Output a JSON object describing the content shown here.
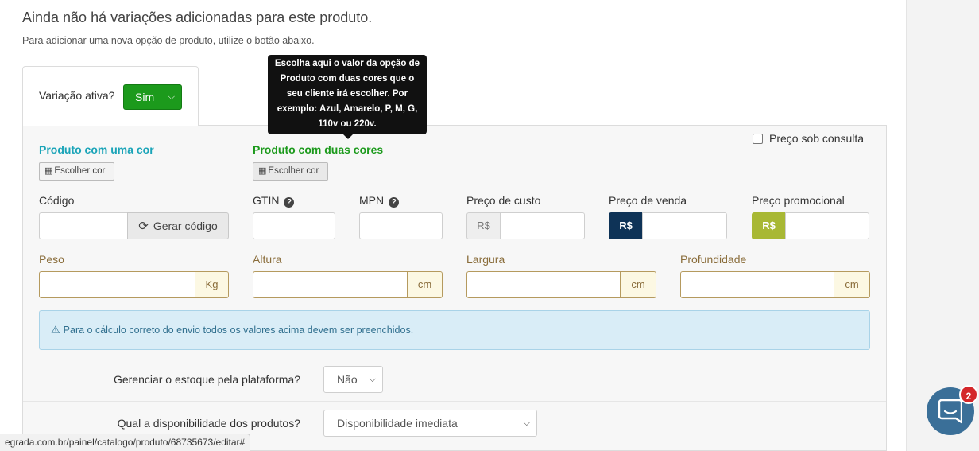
{
  "header": {
    "title": "Ainda não há variações adicionadas para este produto.",
    "subtitle": "Para adicionar uma nova opção de produto, utilize o botão abaixo."
  },
  "variation_tab": {
    "label": "Variação ativa?",
    "selected": "Sim"
  },
  "tooltip": {
    "text": "Escolha aqui o valor da opção de Produto com duas cores que o seu cliente irá escolher. Por exemplo: Azul, Amarelo, P, M, G, 110v ou 220v."
  },
  "price_on_request": {
    "label": "Preço sob consulta"
  },
  "colors": {
    "one": {
      "label": "Produto com uma cor",
      "button": "Escolher cor"
    },
    "two": {
      "label": "Produto com duas cores",
      "button": "Escolher cor"
    }
  },
  "fields": {
    "codigo": {
      "label": "Código",
      "button": "Gerar código"
    },
    "gtin": {
      "label": "GTIN"
    },
    "mpn": {
      "label": "MPN"
    },
    "custo": {
      "label": "Preço de custo",
      "addon": "R$"
    },
    "venda": {
      "label": "Preço de venda",
      "addon": "R$"
    },
    "promo": {
      "label": "Preço promocional",
      "addon": "R$"
    }
  },
  "dimensions": {
    "peso": {
      "label": "Peso",
      "unit": "Kg"
    },
    "altura": {
      "label": "Altura",
      "unit": "cm"
    },
    "largura": {
      "label": "Largura",
      "unit": "cm"
    },
    "profundidade": {
      "label": "Profundidade",
      "unit": "cm"
    }
  },
  "alert": {
    "text": "Para o cálculo correto do envio todos os valores acima devem ser preenchidos."
  },
  "stock": {
    "label": "Gerenciar o estoque pela plataforma?",
    "selected": "Não"
  },
  "availability": {
    "label": "Qual a disponibilidade dos produtos?",
    "selected": "Disponibilidade imediata"
  },
  "statusbar": {
    "url": "egrada.com.br/painel/catalogo/produto/68735673/editar#"
  },
  "chat": {
    "badge": "2"
  },
  "colors_theme": {
    "green": "#1c9a1c",
    "teal": "#1aa4b8",
    "navy": "#0e3357",
    "lime": "#a8b834",
    "info_bg": "#d9edf7",
    "warning_text": "#8a6d3b"
  }
}
